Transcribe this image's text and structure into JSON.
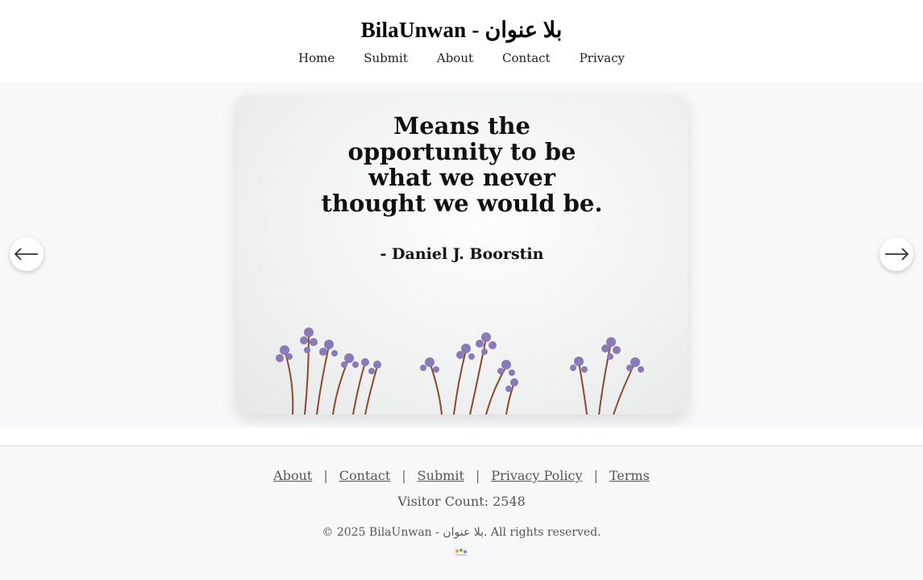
{
  "header": {
    "title": "BilaUnwan - بلا عنوان",
    "nav": [
      "Home",
      "Submit",
      "About",
      "Contact",
      "Privacy"
    ]
  },
  "carousel": {
    "quote_lines": [
      "Means the",
      "opportunity to be",
      "what we never",
      "thought we would be."
    ],
    "author": "- Daniel J. Boorstin",
    "prev_icon": "arrow-left-icon",
    "next_icon": "arrow-right-icon"
  },
  "footer": {
    "links": [
      "About",
      "Contact",
      "Submit",
      "Privacy Policy",
      "Terms"
    ],
    "separator": "|",
    "visitor_count": "Visitor Count: 2548",
    "copyright": "© 2025 BilaUnwan - بلا عنوان. All rights reserved."
  },
  "colors": {
    "page_bg": "#f7f8fa",
    "header_bg": "#ffffff",
    "flower_purple": "#8a7bb8",
    "stem_brown": "#8b4a2b"
  }
}
